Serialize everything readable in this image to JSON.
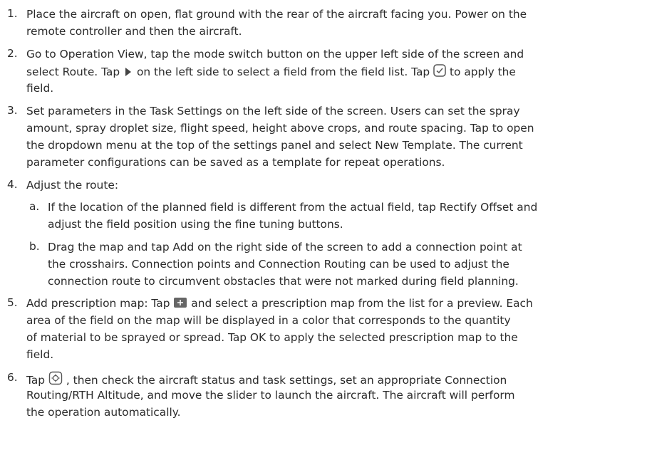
{
  "steps": [
    {
      "n": "1.",
      "lines": [
        "Place the aircraft on open, flat ground with the rear of the aircraft facing you. Power on the",
        "remote controller and then the aircraft."
      ]
    },
    {
      "n": "2.",
      "l1": "Go to Operation View, tap the mode switch button on the upper left side of the screen and",
      "l2a": "select Route. Tap",
      "l2b": "on the left side to select a field from the field list. Tap",
      "l2c": "to apply the",
      "l3": "field."
    },
    {
      "n": "3.",
      "lines": [
        "Set parameters in the Task Settings on the left side of the screen. Users can set the spray",
        "amount, spray droplet size, flight speed, height above crops, and route spacing. Tap to open",
        "the dropdown menu at the top of the settings panel and select New Template. The current",
        "parameter configurations can be saved as a template for repeat operations."
      ]
    },
    {
      "n": "4.",
      "lines": [
        "Adjust the route:"
      ]
    },
    {
      "n": "a.",
      "lines": [
        "If the location of the planned field is different from the actual field, tap Rectify Offset and",
        "adjust the field position using the fine tuning buttons."
      ]
    },
    {
      "n": "b.",
      "lines": [
        "Drag the map and tap Add on the right side of the screen to add a connection point at",
        "the crosshairs. Connection points and Connection Routing can be used to adjust the",
        "connection route to circumvent obstacles that were not marked during field planning."
      ]
    },
    {
      "n": "5.",
      "l1a": "Add prescription map: Tap",
      "l1b": "and select a prescription map from the list for a preview. Each",
      "lines": [
        "area of the field on the map will be displayed in a color that corresponds to the quantity",
        "of material to be sprayed or spread. Tap OK to apply the selected prescription map to the",
        "field."
      ]
    },
    {
      "n": "6.",
      "l1a": "Tap",
      "l1b": ", then check the aircraft status and task settings, set an appropriate Connection",
      "lines": [
        "Routing/RTH Altitude, and move the slider to launch the aircraft. The aircraft will perform",
        "the operation automatically."
      ]
    }
  ],
  "icons": {
    "arrow": "play-arrow-icon",
    "apply": "checkbox-apply-icon",
    "presc": "prescription-map-add-icon",
    "takeoff": "takeoff-icon"
  }
}
